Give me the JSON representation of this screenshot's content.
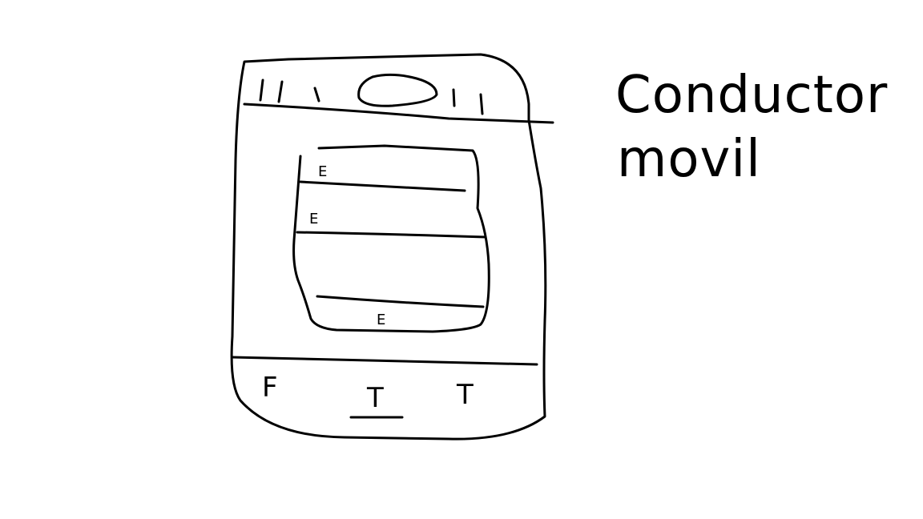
{
  "phone": {
    "status_bar": "|||  ||",
    "form": {
      "fields": [
        {
          "label": "E"
        },
        {
          "label": "E"
        },
        {
          "label": "E"
        }
      ]
    },
    "bottom_nav": [
      {
        "label": "F"
      },
      {
        "label": "T"
      },
      {
        "label": "T"
      }
    ]
  },
  "note": {
    "line1": "Conductor",
    "line2": "movil"
  },
  "colors": {
    "ink": "#000000",
    "paper": "#ffffff"
  }
}
